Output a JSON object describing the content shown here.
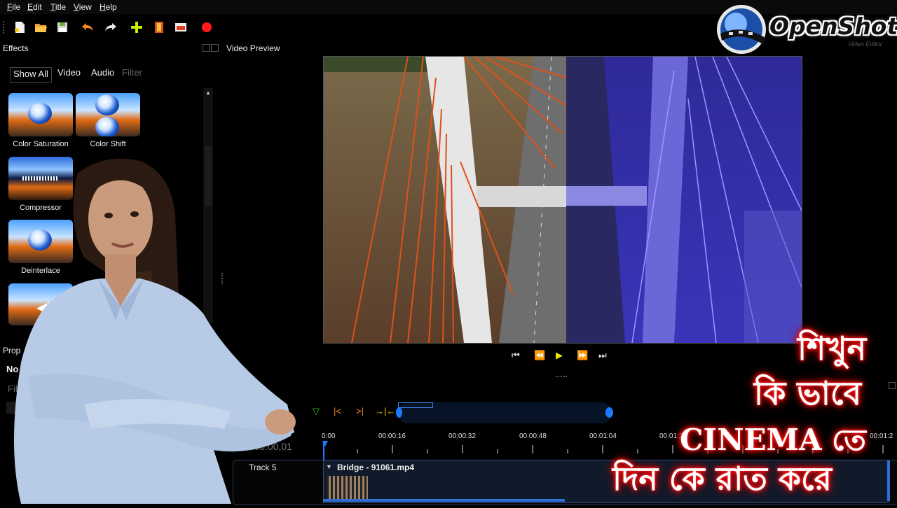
{
  "menu": [
    "File",
    "Edit",
    "Title",
    "View",
    "Help"
  ],
  "toolbar_icons": [
    "new-project-icon",
    "open-project-icon",
    "save-project-icon",
    "undo-icon",
    "redo-icon",
    "import-files-icon",
    "profile-icon",
    "fullscreen-icon",
    "export-video-icon"
  ],
  "logo": {
    "name": "OpenShot",
    "sub": "Video Editor"
  },
  "effects": {
    "title": "Effects",
    "tabs": {
      "all": "Show All",
      "video": "Video",
      "audio": "Audio",
      "filter_placeholder": "Filter"
    },
    "items": [
      {
        "label": "Color Saturation",
        "icon": "color-saturation-icon"
      },
      {
        "label": "Color Shift",
        "icon": "color-shift-icon"
      },
      {
        "label": "Compressor",
        "icon": "compressor-icon"
      },
      {
        "label": "Deinterlace",
        "icon": "deinterlace-icon"
      },
      {
        "label": "",
        "icon": "volume-icon"
      }
    ]
  },
  "preview": {
    "title": "Video Preview"
  },
  "properties": {
    "title": "Prop",
    "no_selection": "No S",
    "filter_placeholder": "Filter"
  },
  "transport": [
    "jump-start-icon",
    "rewind-icon",
    "play-icon",
    "fast-forward-icon",
    "jump-end-icon"
  ],
  "timeline": {
    "timecode": "00:00:00,01",
    "ticks": [
      "0:00",
      "00:00:16",
      "00:00:32",
      "00:00:48",
      "00:01:04",
      "00:01:2",
      "00:01:2"
    ],
    "track": {
      "name": "Track 5"
    },
    "clip": {
      "name": "Bridge - 91061.mp4"
    }
  },
  "overlay_text": {
    "line1": "শিখুন",
    "line2": "কি ভাবে",
    "line3": "CINEMA তে",
    "line4": "দিন কে রাত করে"
  },
  "colors": {
    "overlay_glow": "#ff1a1a",
    "accent_blue": "#1b7bff",
    "play": "#e8e800"
  }
}
